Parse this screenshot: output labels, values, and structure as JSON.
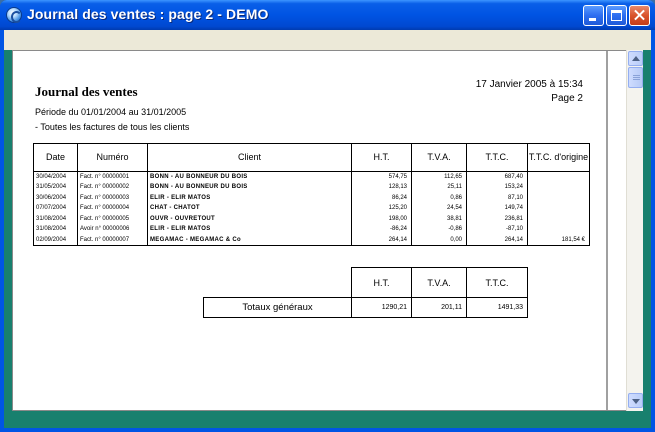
{
  "window": {
    "title": "Journal des ventes : page 2 - DEMO"
  },
  "document": {
    "title": "Journal des ventes",
    "date": "17 Janvier 2005 à 15:34",
    "page": "Page  2",
    "period": "Période du 01/01/2004 au 31/01/2005",
    "filter": "- Toutes les factures de tous les clients"
  },
  "table": {
    "headers": {
      "date": "Date",
      "numero": "Numéro",
      "client": "Client",
      "ht": "H.T.",
      "tva": "T.V.A.",
      "ttc": "T.T.C.",
      "ttc_origine": "T.T.C. d'origine"
    },
    "rows": [
      {
        "date": "30/04/2004",
        "numero": "Fact. n° 00000001",
        "client": "BONN - AU BONNEUR DU BOIS",
        "ht": "574,75",
        "tva": "112,65",
        "ttc": "687,40",
        "ttc_origine": ""
      },
      {
        "date": "31/05/2004",
        "numero": "Fact. n° 00000002",
        "client": "BONN - AU BONNEUR DU BOIS",
        "ht": "128,13",
        "tva": "25,11",
        "ttc": "153,24",
        "ttc_origine": ""
      },
      {
        "date": "30/06/2004",
        "numero": "Fact. n° 00000003",
        "client": "ELIR - ELIR MATOS",
        "ht": "86,24",
        "tva": "0,86",
        "ttc": "87,10",
        "ttc_origine": ""
      },
      {
        "date": "07/07/2004",
        "numero": "Fact. n° 00000004",
        "client": "CHAT - CHATOT",
        "ht": "125,20",
        "tva": "24,54",
        "ttc": "149,74",
        "ttc_origine": ""
      },
      {
        "date": "31/08/2004",
        "numero": "Fact. n° 00000005",
        "client": "OUVR - OUVRETOUT",
        "ht": "198,00",
        "tva": "38,81",
        "ttc": "236,81",
        "ttc_origine": ""
      },
      {
        "date": "31/08/2004",
        "numero": "Avoir n° 00000006",
        "client": "ELIR - ELIR MATOS",
        "ht": "-86,24",
        "tva": "-0,86",
        "ttc": "-87,10",
        "ttc_origine": ""
      },
      {
        "date": "02/09/2004",
        "numero": "Fact. n° 00000007",
        "client": "MEGAMAC - MEGAMAC & Co",
        "ht": "264,14",
        "tva": "0,00",
        "ttc": "264,14",
        "ttc_origine": "181,54 €"
      }
    ]
  },
  "totals": {
    "headers": {
      "ht": "H.T.",
      "tva": "T.V.A.",
      "ttc": "T.T.C."
    },
    "label": "Totaux généraux",
    "ht": "1290,21",
    "tva": "201,11",
    "ttc": "1491,33"
  },
  "icons": {
    "app": "app-icon",
    "minimize": "minimize-icon",
    "maximize": "maximize-icon",
    "close": "close-icon",
    "scroll_up": "arrow-up-icon",
    "scroll_down": "arrow-down-icon"
  }
}
